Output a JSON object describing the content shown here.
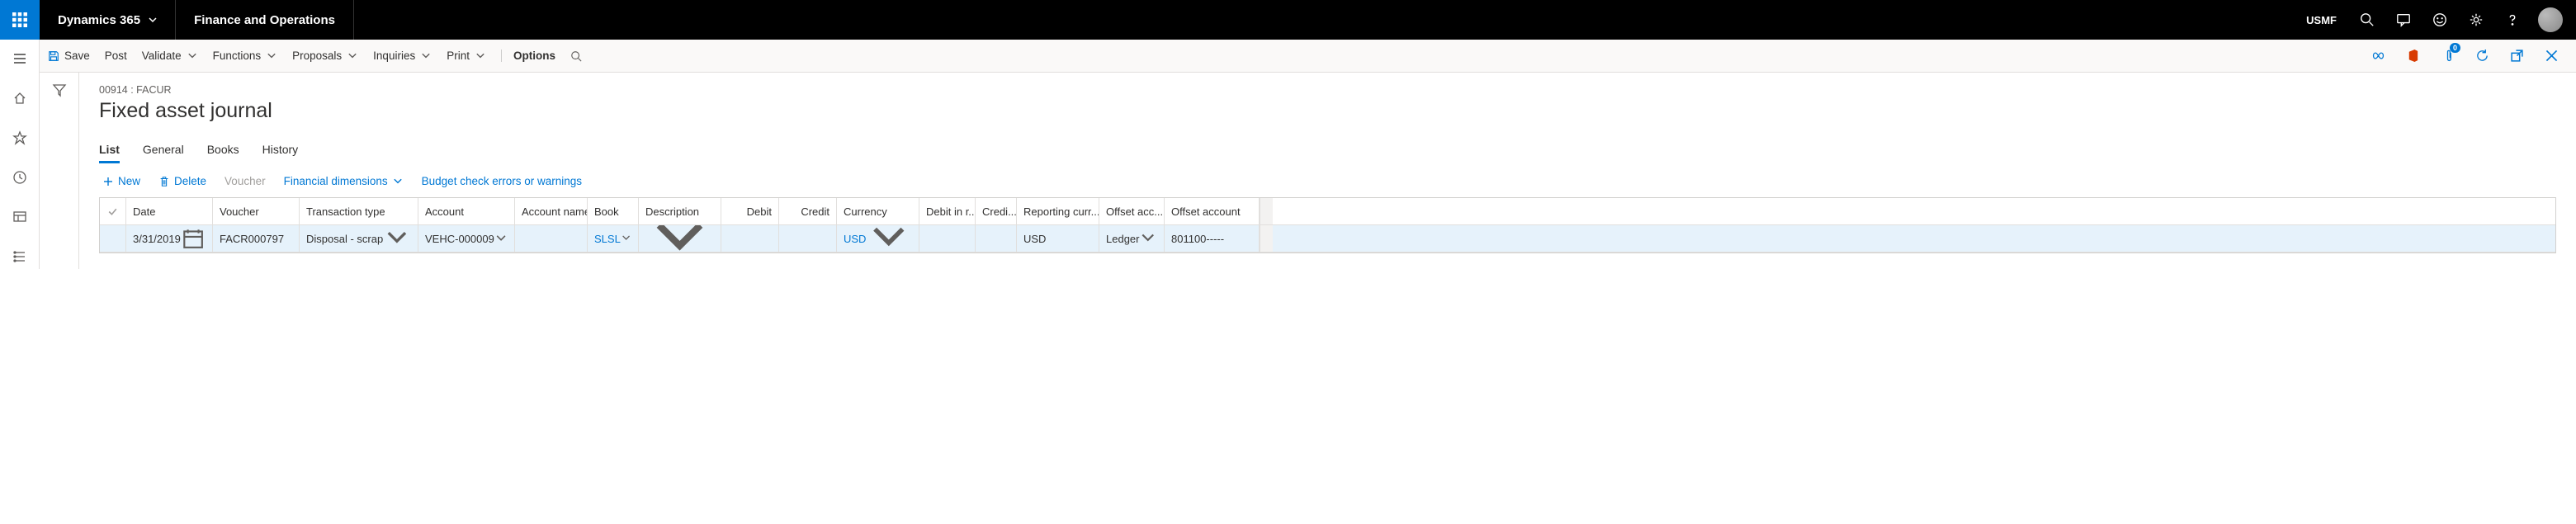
{
  "topbar": {
    "brand": "Dynamics 365",
    "module": "Finance and Operations",
    "entity": "USMF"
  },
  "cmdbar": {
    "save": "Save",
    "post": "Post",
    "validate": "Validate",
    "functions": "Functions",
    "proposals": "Proposals",
    "inquiries": "Inquiries",
    "print": "Print",
    "options": "Options",
    "notif_count": "0"
  },
  "page": {
    "breadcrumb": "00914 : FACUR",
    "title": "Fixed asset journal"
  },
  "tabs": {
    "list": "List",
    "general": "General",
    "books": "Books",
    "history": "History"
  },
  "actions": {
    "new": "New",
    "delete": "Delete",
    "voucher": "Voucher",
    "findim": "Financial dimensions",
    "budget": "Budget check errors or warnings"
  },
  "grid": {
    "headers": {
      "date": "Date",
      "voucher": "Voucher",
      "ttype": "Transaction type",
      "account": "Account",
      "aname": "Account name",
      "book": "Book",
      "desc": "Description",
      "debit": "Debit",
      "credit": "Credit",
      "currency": "Currency",
      "debitinr": "Debit in r...",
      "creditinr": "Credi...",
      "repcurr": "Reporting curr...",
      "offacctype": "Offset acc...",
      "offacc": "Offset account"
    },
    "row": {
      "date": "3/31/2019",
      "voucher": "FACR000797",
      "ttype": "Disposal - scrap",
      "account": "VEHC-000009",
      "aname": "",
      "book": "SLSL",
      "desc": "",
      "debit": "",
      "credit": "",
      "currency": "USD",
      "debitinr": "",
      "creditinr": "",
      "repcurr": "USD",
      "offacctype": "Ledger",
      "offacc": "801100-----"
    }
  }
}
